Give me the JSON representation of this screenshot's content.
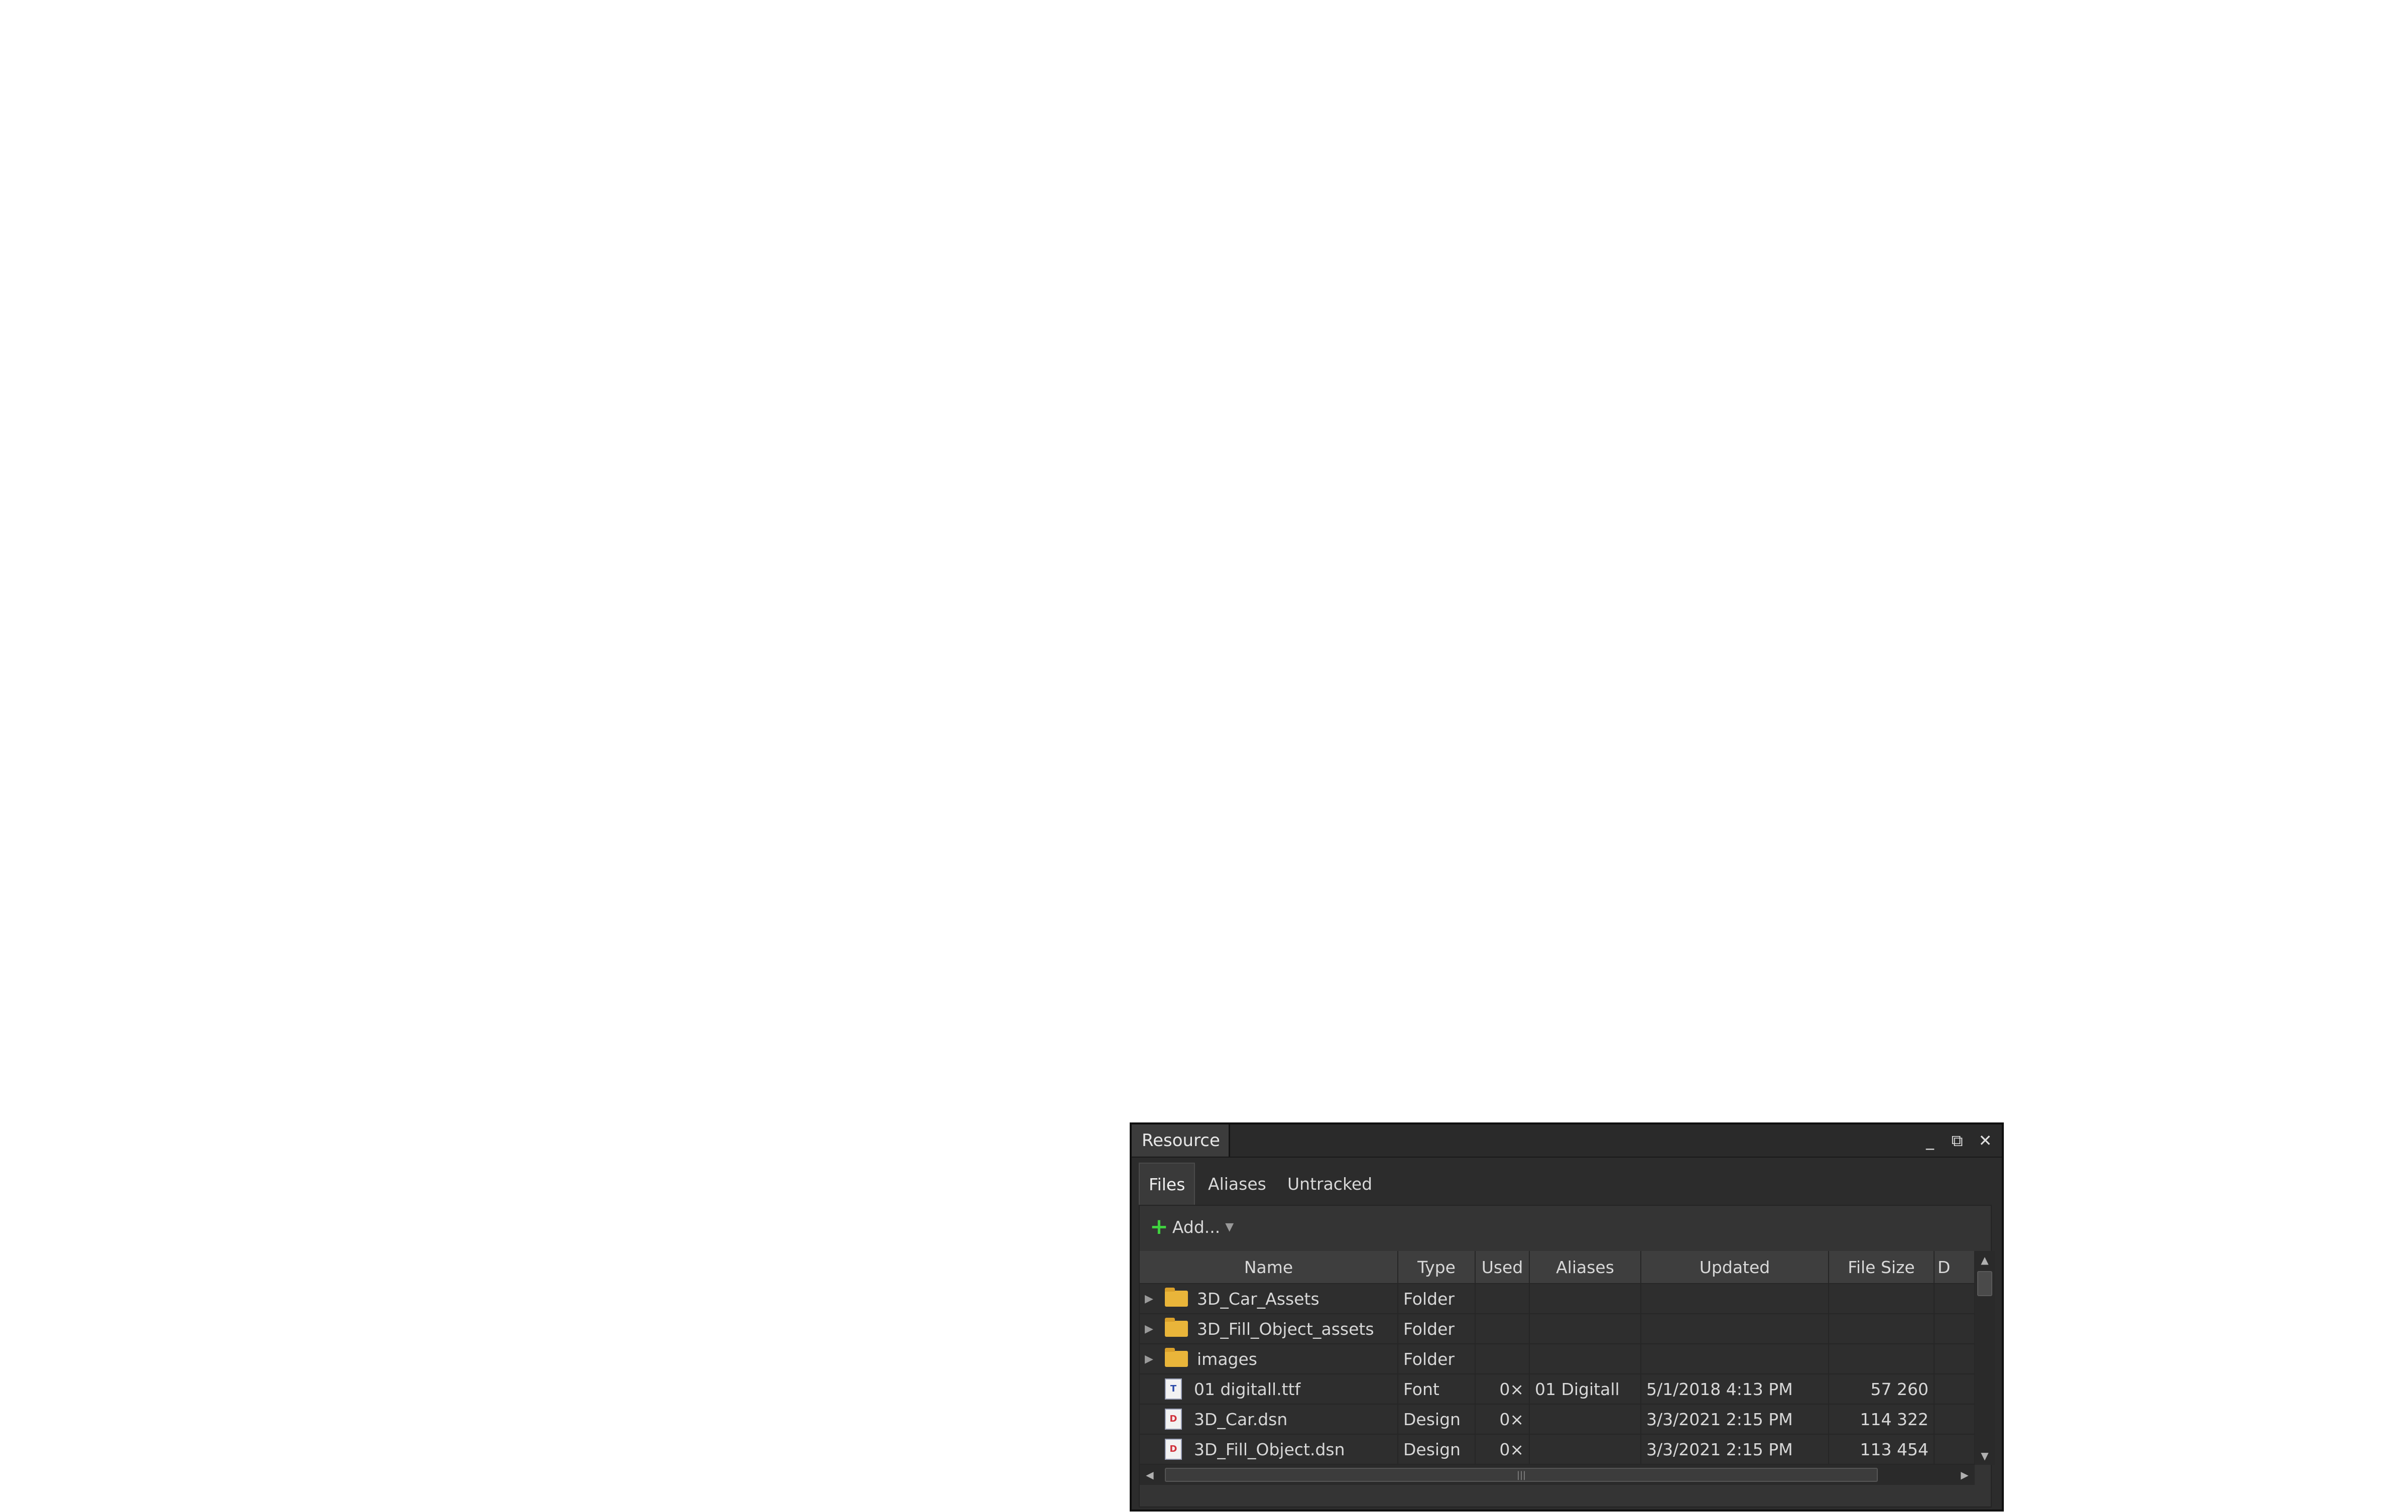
{
  "window": {
    "title": "Resource",
    "minimize_glyph": "_",
    "restore_glyph": "⧉",
    "close_glyph": "✕"
  },
  "tabs": [
    {
      "label": "Files",
      "active": true
    },
    {
      "label": "Aliases",
      "active": false
    },
    {
      "label": "Untracked",
      "active": false
    }
  ],
  "toolbar": {
    "add_label": "Add...",
    "add_icon": "plus-icon"
  },
  "table": {
    "columns": [
      "Name",
      "Type",
      "Used",
      "Aliases",
      "Updated",
      "File Size",
      "D"
    ],
    "rows": [
      {
        "icon": "folder-icon",
        "expandable": true,
        "name": "3D_Car_Assets",
        "type": "Folder",
        "used": "",
        "aliases": "",
        "updated": "",
        "size": ""
      },
      {
        "icon": "folder-icon",
        "expandable": true,
        "name": "3D_Fill_Object_assets",
        "type": "Folder",
        "used": "",
        "aliases": "",
        "updated": "",
        "size": ""
      },
      {
        "icon": "folder-icon",
        "expandable": true,
        "name": "images",
        "type": "Folder",
        "used": "",
        "aliases": "",
        "updated": "",
        "size": ""
      },
      {
        "icon": "font-file-icon",
        "expandable": false,
        "name": "01 digitall.ttf",
        "type": "Font",
        "used": "0×",
        "aliases": "01 Digitall",
        "updated": "5/1/2018 4:13 PM",
        "size": "57 260"
      },
      {
        "icon": "design-file-icon",
        "expandable": false,
        "name": "3D_Car.dsn",
        "type": "Design",
        "used": "0×",
        "aliases": "",
        "updated": "3/3/2021 2:15 PM",
        "size": "114 322"
      },
      {
        "icon": "design-file-icon",
        "expandable": false,
        "name": "3D_Fill_Object.dsn",
        "type": "Design",
        "used": "0×",
        "aliases": "",
        "updated": "3/3/2021 2:15 PM",
        "size": "113 454"
      }
    ]
  }
}
